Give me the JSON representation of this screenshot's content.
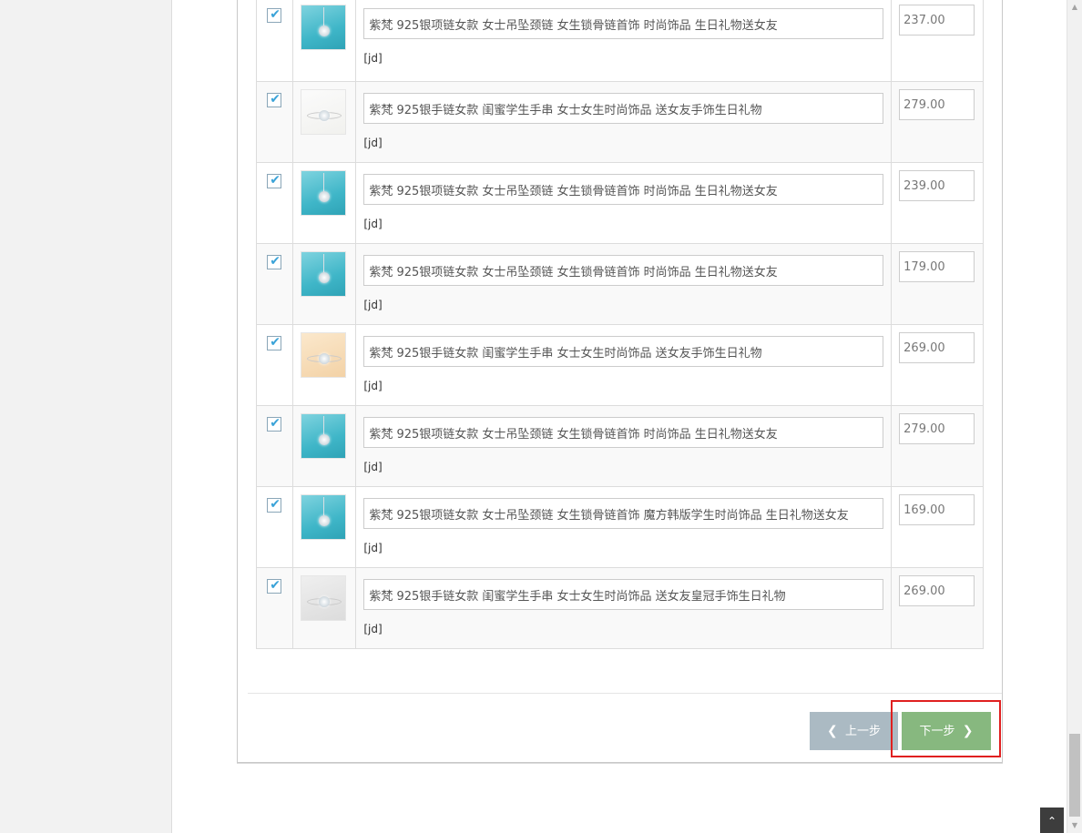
{
  "products": [
    {
      "checked": true,
      "thumb": "teal",
      "title": "紫梵 925银项链女款 女士吊坠颈链 女生锁骨链首饰 时尚饰品 生日礼物送女友",
      "source": "[jd]",
      "price": "237.00"
    },
    {
      "checked": true,
      "thumb": "white",
      "title": "紫梵 925银手链女款 闺蜜学生手串 女士女生时尚饰品 送女友手饰生日礼物",
      "source": "[jd]",
      "price": "279.00"
    },
    {
      "checked": true,
      "thumb": "teal",
      "title": "紫梵 925银项链女款 女士吊坠颈链 女生锁骨链首饰 时尚饰品 生日礼物送女友",
      "source": "[jd]",
      "price": "239.00"
    },
    {
      "checked": true,
      "thumb": "teal",
      "title": "紫梵 925银项链女款 女士吊坠颈链 女生锁骨链首饰 时尚饰品 生日礼物送女友",
      "source": "[jd]",
      "price": "179.00"
    },
    {
      "checked": true,
      "thumb": "cream",
      "title": "紫梵 925银手链女款 闺蜜学生手串 女士女生时尚饰品 送女友手饰生日礼物",
      "source": "[jd]",
      "price": "269.00"
    },
    {
      "checked": true,
      "thumb": "teal",
      "title": "紫梵 925银项链女款 女士吊坠颈链 女生锁骨链首饰 时尚饰品 生日礼物送女友",
      "source": "[jd]",
      "price": "279.00"
    },
    {
      "checked": true,
      "thumb": "teal",
      "title": "紫梵 925银项链女款 女士吊坠颈链 女生锁骨链首饰 魔方韩版学生时尚饰品 生日礼物送女友",
      "source": "[jd]",
      "price": "169.00"
    },
    {
      "checked": true,
      "thumb": "grey",
      "title": "紫梵 925银手链女款 闺蜜学生手串 女士女生时尚饰品 送女友皇冠手饰生日礼物",
      "source": "[jd]",
      "price": "269.00"
    }
  ],
  "footer": {
    "prev_label": "上一步",
    "next_label": "下一步",
    "prev_icon": "chevron-left-icon",
    "next_icon": "chevron-right-icon"
  },
  "scroll_to_top_icon": "double-chevron-up-icon",
  "colors": {
    "prev_button": "#abbac3",
    "next_button": "#87b87f",
    "highlight": "#e02020",
    "checkbox_mark": "#3aa3d8"
  }
}
